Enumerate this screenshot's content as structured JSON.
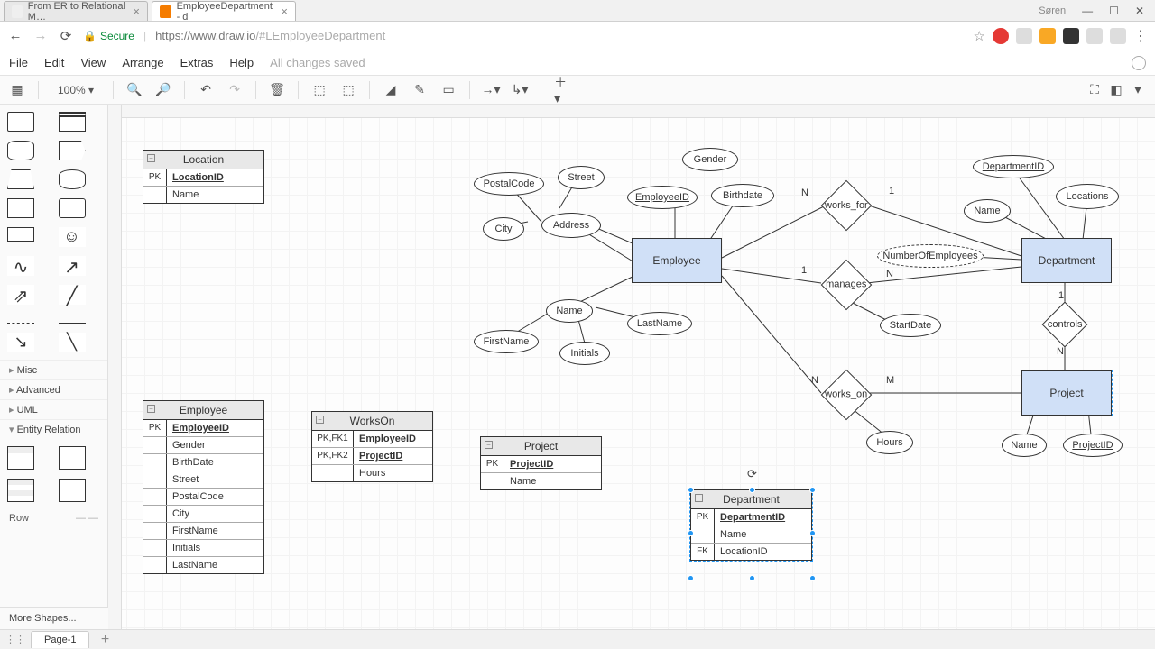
{
  "browser": {
    "tabs": [
      {
        "title": "From ER to Relational M…",
        "active": false
      },
      {
        "title": "EmployeeDepartment - d",
        "active": true
      }
    ],
    "user": "Søren",
    "secure_label": "Secure",
    "url_host": "https://www.draw.io",
    "url_path": "/#LEmployeeDepartment"
  },
  "menu": {
    "items": [
      "File",
      "Edit",
      "View",
      "Arrange",
      "Extras",
      "Help"
    ],
    "status": "All changes saved"
  },
  "toolbar": {
    "zoom": "100%"
  },
  "sidebar": {
    "categories": [
      "Misc",
      "Advanced",
      "UML",
      "Entity Relation"
    ],
    "open_category": "Entity Relation",
    "row_label": "Row",
    "more": "More Shapes..."
  },
  "pagebar": {
    "page": "Page-1"
  },
  "er": {
    "entities": {
      "employee": "Employee",
      "department": "Department",
      "project": "Project"
    },
    "relationships": {
      "works_for": "works_for",
      "manages": "manages",
      "works_on": "works_on",
      "controls": "controls"
    },
    "attributes": {
      "gender": "Gender",
      "birthdate": "Birthdate",
      "employeeid": "EmployeeID",
      "address": "Address",
      "postalcode": "PostalCode",
      "street": "Street",
      "city": "City",
      "name_emp": "Name",
      "firstname": "FirstName",
      "lastname": "LastName",
      "initials": "Initials",
      "departmentid": "DepartmentID",
      "locations": "Locations",
      "name_dept": "Name",
      "numemp": "NumberOfEmployees",
      "startdate": "StartDate",
      "hours": "Hours",
      "name_proj": "Name",
      "projectid": "ProjectID"
    },
    "cardinalities": {
      "n": "N",
      "one": "1",
      "m": "M"
    }
  },
  "tables": {
    "location": {
      "title": "Location",
      "rows": [
        {
          "key": "PK",
          "val": "LocationID",
          "pk": true
        },
        {
          "key": "",
          "val": "Name"
        }
      ]
    },
    "employee": {
      "title": "Employee",
      "rows": [
        {
          "key": "PK",
          "val": "EmployeeID",
          "pk": true
        },
        {
          "key": "",
          "val": "Gender"
        },
        {
          "key": "",
          "val": "BirthDate"
        },
        {
          "key": "",
          "val": "Street"
        },
        {
          "key": "",
          "val": "PostalCode"
        },
        {
          "key": "",
          "val": "City"
        },
        {
          "key": "",
          "val": "FirstName"
        },
        {
          "key": "",
          "val": "Initials"
        },
        {
          "key": "",
          "val": "LastName"
        }
      ]
    },
    "workson": {
      "title": "WorksOn",
      "rows": [
        {
          "key": "PK,FK1",
          "val": "EmployeeID",
          "pk": true
        },
        {
          "key": "PK,FK2",
          "val": "ProjectID",
          "pk": true
        },
        {
          "key": "",
          "val": "Hours"
        }
      ]
    },
    "project": {
      "title": "Project",
      "rows": [
        {
          "key": "PK",
          "val": "ProjectID",
          "pk": true
        },
        {
          "key": "",
          "val": "Name"
        }
      ]
    },
    "department": {
      "title": "Department",
      "rows": [
        {
          "key": "PK",
          "val": "DepartmentID",
          "pk": true
        },
        {
          "key": "",
          "val": "Name"
        },
        {
          "key": "FK",
          "val": "LocationID"
        }
      ]
    }
  }
}
